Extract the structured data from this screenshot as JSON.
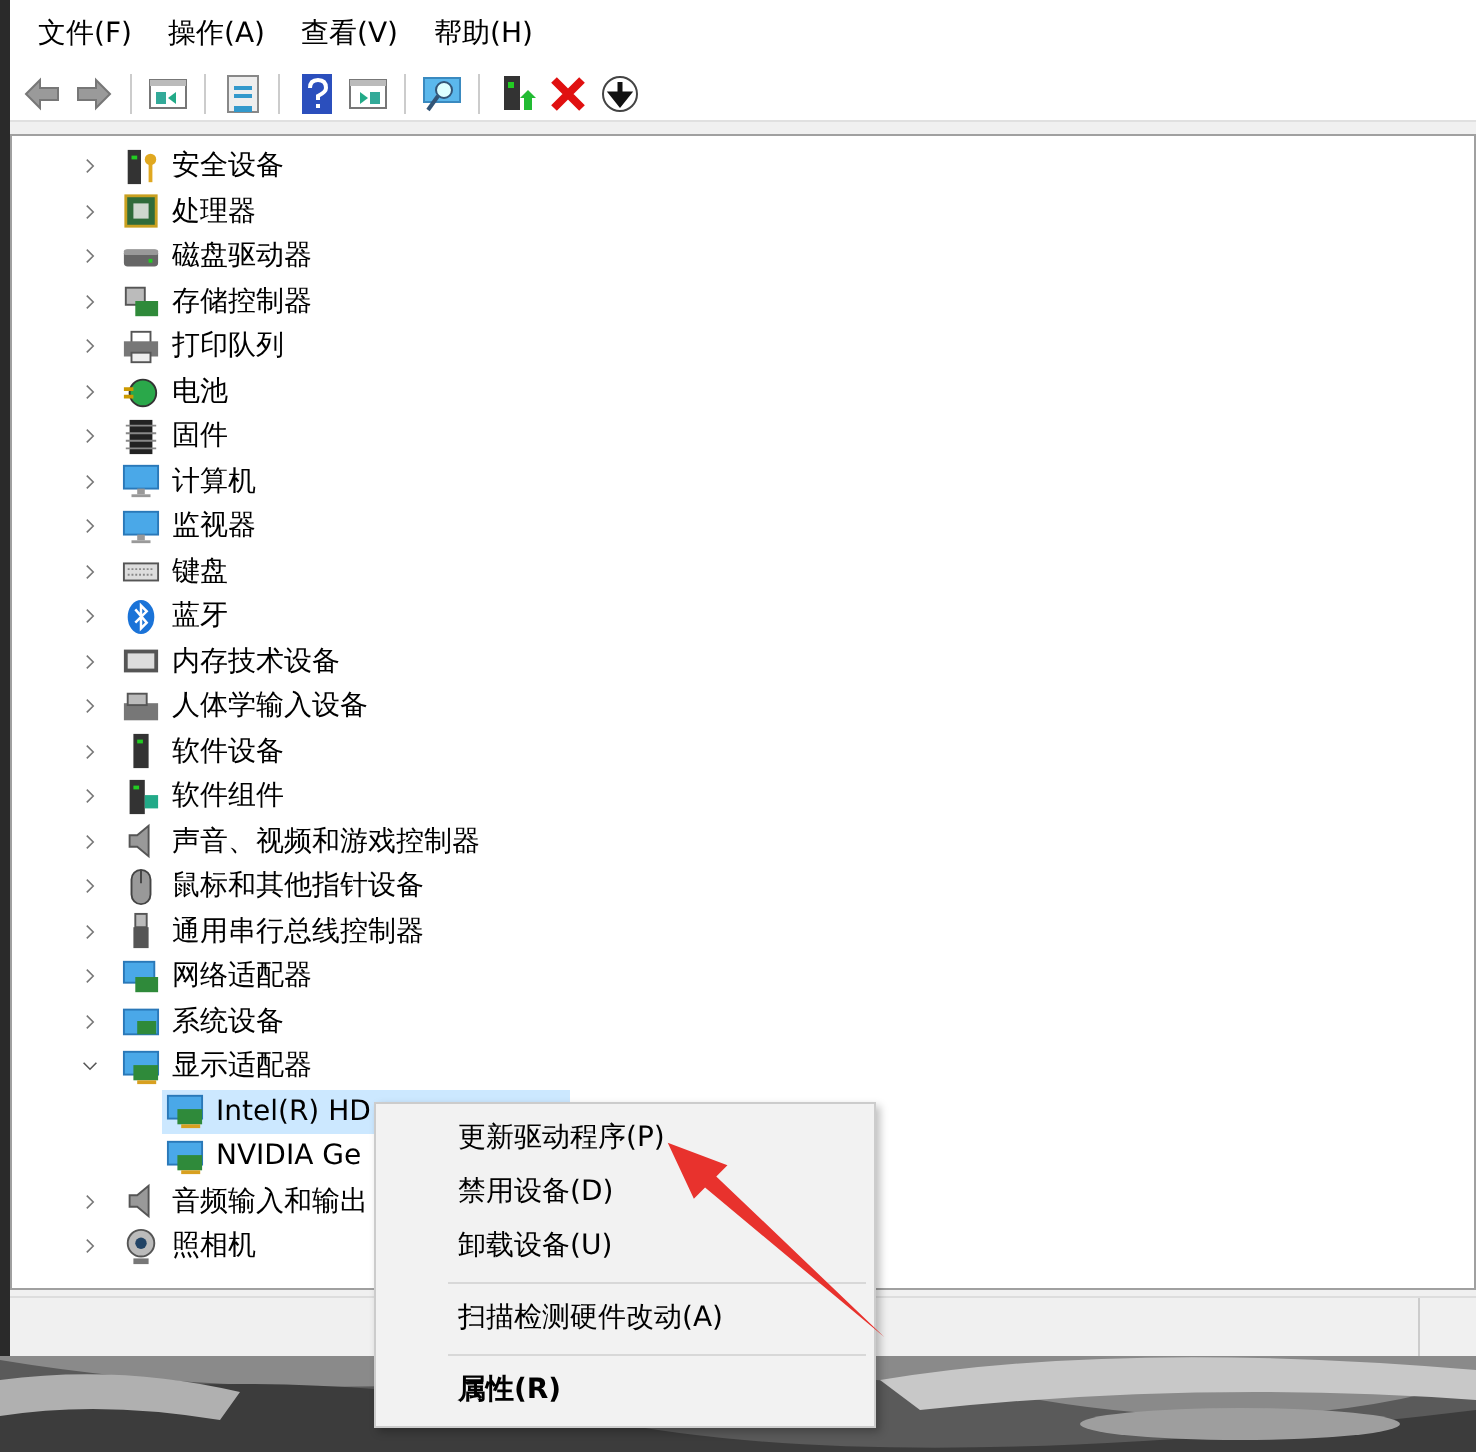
{
  "menu_bar": [
    "文件(F)",
    "操作(A)",
    "查看(V)",
    "帮助(H)"
  ],
  "tree": [
    {
      "label": "安全设备",
      "expanded": false
    },
    {
      "label": "处理器",
      "expanded": false
    },
    {
      "label": "磁盘驱动器",
      "expanded": false
    },
    {
      "label": "存储控制器",
      "expanded": false
    },
    {
      "label": "打印队列",
      "expanded": false
    },
    {
      "label": "电池",
      "expanded": false
    },
    {
      "label": "固件",
      "expanded": false
    },
    {
      "label": "计算机",
      "expanded": false
    },
    {
      "label": "监视器",
      "expanded": false
    },
    {
      "label": "键盘",
      "expanded": false
    },
    {
      "label": "蓝牙",
      "expanded": false
    },
    {
      "label": "内存技术设备",
      "expanded": false
    },
    {
      "label": "人体学输入设备",
      "expanded": false
    },
    {
      "label": "软件设备",
      "expanded": false
    },
    {
      "label": "软件组件",
      "expanded": false
    },
    {
      "label": "声音、视频和游戏控制器",
      "expanded": false
    },
    {
      "label": "鼠标和其他指针设备",
      "expanded": false
    },
    {
      "label": "通用串行总线控制器",
      "expanded": false
    },
    {
      "label": "网络适配器",
      "expanded": false
    },
    {
      "label": "系统设备",
      "expanded": false
    },
    {
      "label": "显示适配器",
      "expanded": true,
      "children": [
        {
          "label": "Intel(R) HD",
          "selected": true
        },
        {
          "label": "NVIDIA Ge",
          "selected": false
        }
      ]
    },
    {
      "label": "音频输入和输出",
      "expanded": false
    },
    {
      "label": "照相机",
      "expanded": false
    }
  ],
  "context_menu": [
    {
      "label": "更新驱动程序(P)",
      "kind": "item"
    },
    {
      "label": "禁用设备(D)",
      "kind": "item"
    },
    {
      "label": "卸载设备(U)",
      "kind": "item"
    },
    {
      "kind": "separator"
    },
    {
      "label": "扫描检测硬件改动(A)",
      "kind": "item"
    },
    {
      "kind": "separator"
    },
    {
      "label": "属性(R)",
      "kind": "default"
    }
  ]
}
